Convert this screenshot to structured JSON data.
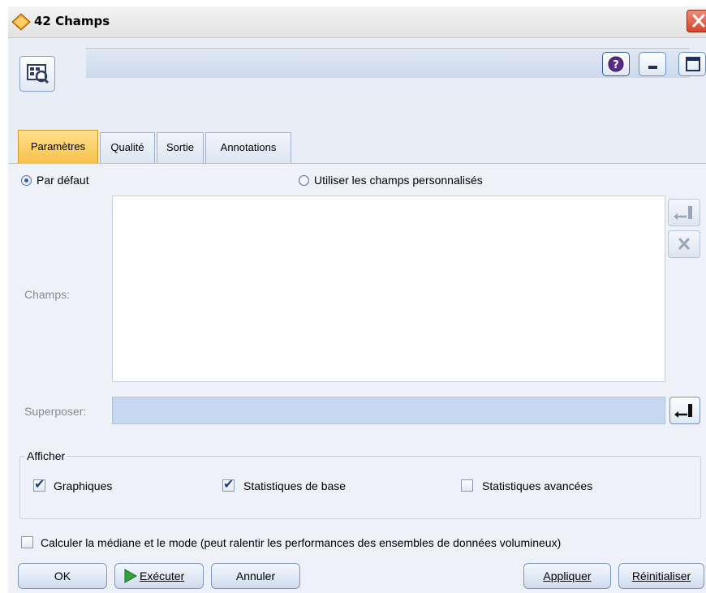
{
  "window": {
    "title": "42 Champs"
  },
  "tabs": [
    "Paramètres",
    "Qualité",
    "Sortie",
    "Annotations"
  ],
  "active_tab": "Paramètres",
  "mode": {
    "default_label": "Par défaut",
    "custom_label": "Utiliser les champs personnalisés",
    "selected": "default"
  },
  "fields": {
    "label": "Champs:",
    "items": []
  },
  "overlay": {
    "label": "Superposer:",
    "value": ""
  },
  "display": {
    "legend": "Afficher",
    "graphs": {
      "label": "Graphiques",
      "checked": true
    },
    "basic_stats": {
      "label": "Statistiques de base",
      "checked": true
    },
    "advanced_stats": {
      "label": "Statistiques avancées",
      "checked": false
    }
  },
  "median_mode": {
    "label": "Calculer la médiane et le mode (peut ralentir les performances des ensembles de données volumineux)",
    "checked": false
  },
  "buttons": {
    "ok": "OK",
    "execute": "Exécuter",
    "cancel": "Annuler",
    "apply": "Appliquer",
    "reset": "Réinitialiser"
  }
}
